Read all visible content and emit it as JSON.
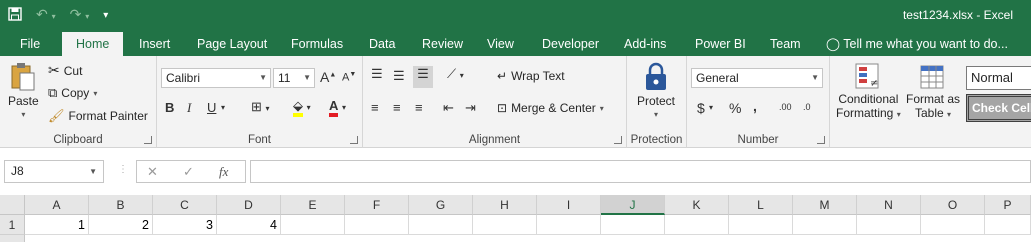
{
  "window": {
    "title": "test1234.xlsx - Excel"
  },
  "tabs": [
    {
      "label": "File"
    },
    {
      "label": "Home"
    },
    {
      "label": "Insert"
    },
    {
      "label": "Page Layout"
    },
    {
      "label": "Formulas"
    },
    {
      "label": "Data"
    },
    {
      "label": "Review"
    },
    {
      "label": "View"
    },
    {
      "label": "Developer"
    },
    {
      "label": "Add-ins"
    },
    {
      "label": "Power BI"
    },
    {
      "label": "Team"
    }
  ],
  "tell_me": "Tell me what you want to do...",
  "clipboard": {
    "paste": "Paste",
    "cut": "Cut",
    "copy": "Copy",
    "format_painter": "Format Painter",
    "label": "Clipboard"
  },
  "font": {
    "name": "Calibri",
    "size": "11",
    "bold": "B",
    "italic": "I",
    "underline": "U",
    "label": "Font"
  },
  "alignment": {
    "wrap": "Wrap Text",
    "merge": "Merge & Center",
    "label": "Alignment"
  },
  "protection": {
    "protect": "Protect",
    "label": "Protection"
  },
  "number": {
    "format": "General",
    "currency": "$",
    "percent": "%",
    "comma": ",",
    "inc_decimal": ".00",
    "dec_decimal": ".0",
    "label": "Number"
  },
  "styles": {
    "conditional": "Conditional",
    "formatting": "Formatting",
    "format_as": "Format as",
    "table": "Table",
    "normal": "Normal",
    "check_cell": "Check Cell"
  },
  "formula_bar": {
    "name_box": "J8",
    "fx": "fx",
    "value": ""
  },
  "columns": [
    "A",
    "B",
    "C",
    "D",
    "E",
    "F",
    "G",
    "H",
    "I",
    "J",
    "K",
    "L",
    "M",
    "N",
    "O",
    "P"
  ],
  "selected_column": "J",
  "rows": [
    {
      "num": "1",
      "cells": [
        "1",
        "2",
        "3",
        "4",
        "",
        "",
        "",
        "",
        "",
        "",
        "",
        "",
        "",
        "",
        "",
        ""
      ]
    }
  ]
}
